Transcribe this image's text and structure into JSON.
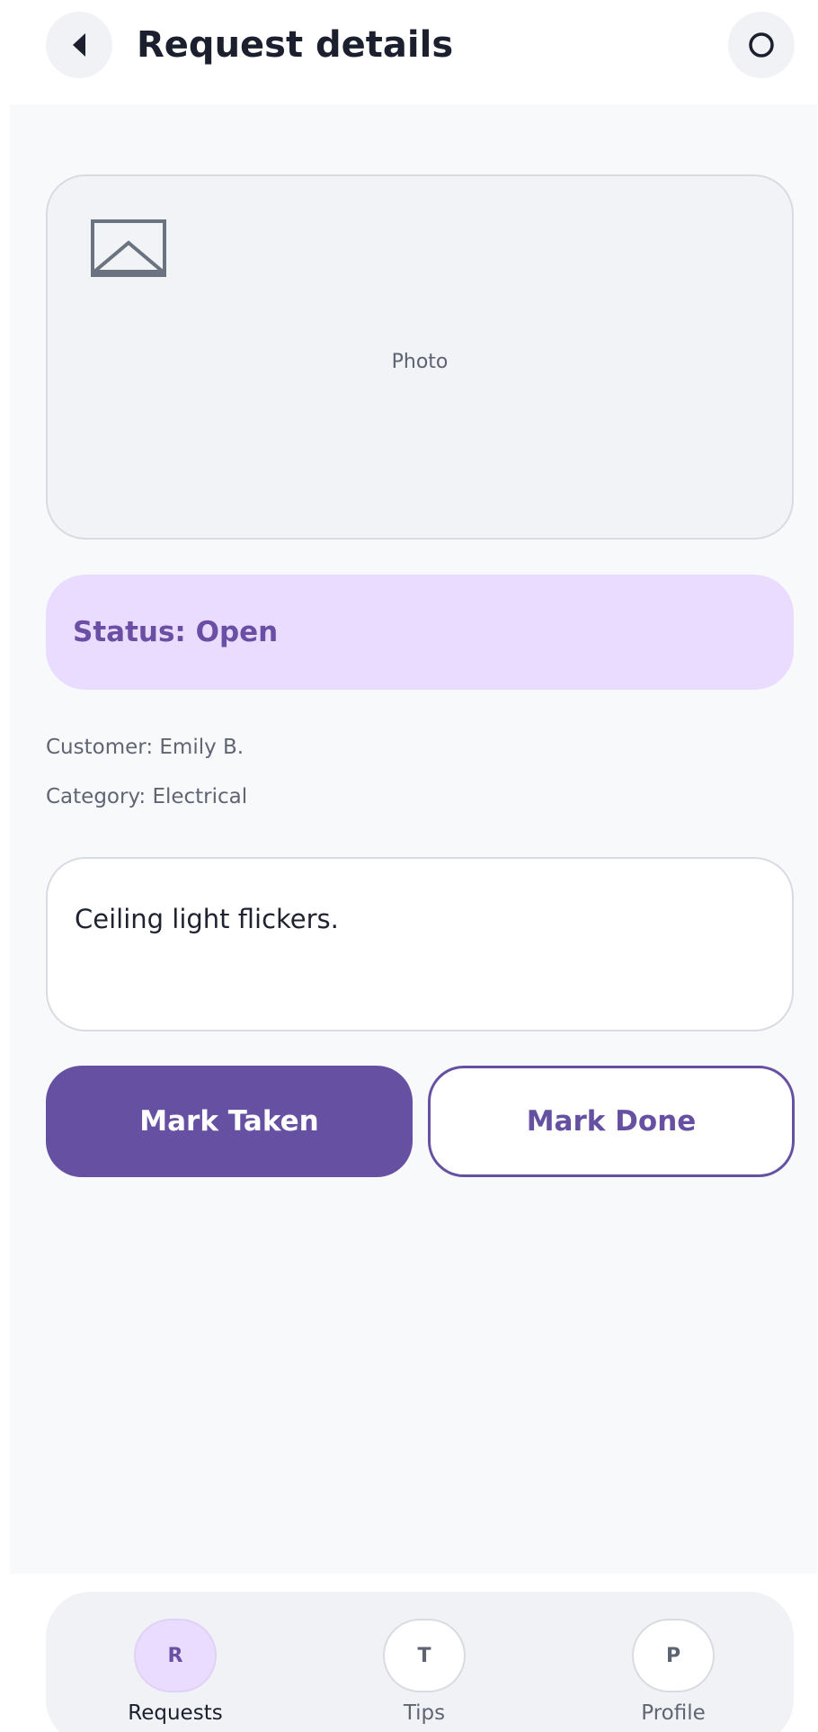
{
  "header": {
    "title": "Request details",
    "back_icon": "triangle-left-icon",
    "more_icon": "circle-icon"
  },
  "photo": {
    "icon": "image-icon",
    "label": "Photo"
  },
  "status": {
    "text": "Status: Open"
  },
  "meta": {
    "customer": "Customer: Emily B.",
    "category": "Category: Electrical"
  },
  "description": {
    "text": "Ceiling light flickers."
  },
  "actions": {
    "mark_taken_label": "Mark Taken",
    "mark_done_label": "Mark Done"
  },
  "nav": {
    "items": [
      {
        "badge": "R",
        "label": "Requests",
        "active": true
      },
      {
        "badge": "T",
        "label": "Tips",
        "active": false
      },
      {
        "badge": "P",
        "label": "Profile",
        "active": false
      }
    ]
  },
  "colors": {
    "accent": "#6650a2",
    "status_bg": "#eadcfe",
    "status_text": "#6b4fa5",
    "content_bg": "#f8f9fa"
  }
}
